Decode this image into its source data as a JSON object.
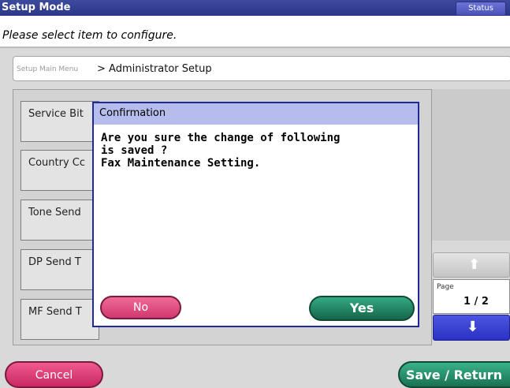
{
  "header": {
    "title": "Setup Mode",
    "status_label": "Status"
  },
  "prompt": {
    "text": "Please select item to configure."
  },
  "breadcrumb": {
    "root": "Setup Main Menu",
    "current": "> Administrator Setup"
  },
  "menu_items": [
    {
      "label": "Service Bit"
    },
    {
      "label": "Country Cc"
    },
    {
      "label": "Tone Send"
    },
    {
      "label": "DP Send T"
    },
    {
      "label": "MF Send T"
    }
  ],
  "pager": {
    "label": "Page",
    "value": "1 / 2",
    "up_icon": "arrow-up-icon",
    "down_icon": "arrow-down-icon"
  },
  "dialog": {
    "title": "Confirmation",
    "message_lines": [
      "Are you sure the change of following",
      "is saved ?",
      "Fax Maintenance Setting."
    ],
    "no_label": "No",
    "yes_label": "Yes"
  },
  "footer": {
    "cancel_label": "Cancel",
    "save_label": "Save / Return"
  },
  "colors": {
    "title_bar": "#2c3787",
    "dialog_border": "#1f2a9a",
    "cancel_pink": "#d0386f",
    "confirm_green": "#187152"
  }
}
